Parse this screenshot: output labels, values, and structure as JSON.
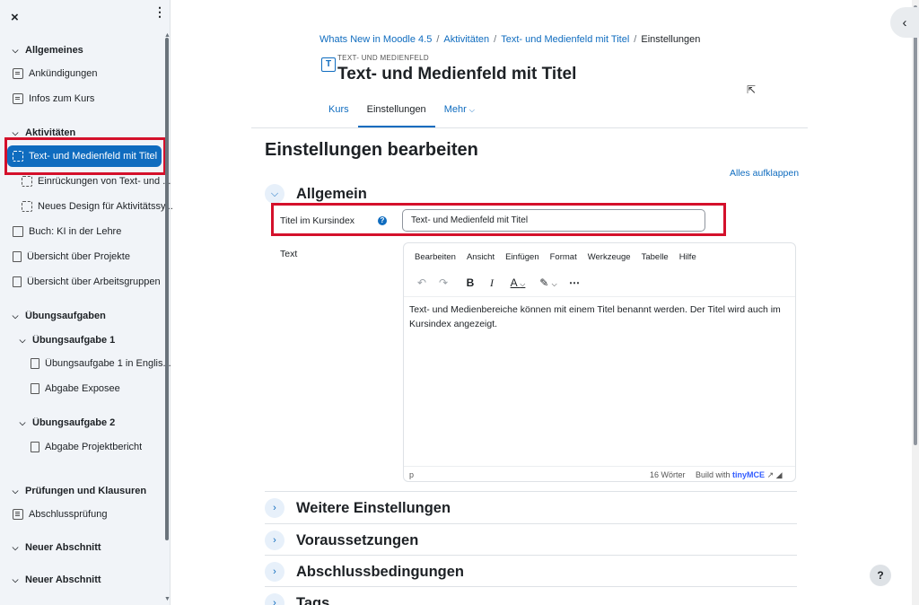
{
  "sidebar": {
    "close_icon": "×",
    "more_icon": "⋮",
    "items": [
      {
        "label": "Allgemeines"
      },
      {
        "label": "Ankündigungen"
      },
      {
        "label": "Infos zum Kurs"
      },
      {
        "label": "Aktivitäten"
      },
      {
        "label": "Text- und Medienfeld mit Titel"
      },
      {
        "label": "Einrückungen von Text- und ..."
      },
      {
        "label": "Neues Design für Aktivitätssy..."
      },
      {
        "label": "Buch: KI in der Lehre"
      },
      {
        "label": "Übersicht über Projekte"
      },
      {
        "label": "Übersicht über Arbeitsgruppen"
      },
      {
        "label": "Übungsaufgaben"
      },
      {
        "label": "Übungsaufgabe 1"
      },
      {
        "label": "Übungsaufgabe 1 in Englis..."
      },
      {
        "label": "Abgabe Exposee"
      },
      {
        "label": "Übungsaufgabe 2"
      },
      {
        "label": "Abgabe Projektbericht"
      },
      {
        "label": "Prüfungen und Klausuren"
      },
      {
        "label": "Abschlussprüfung"
      },
      {
        "label": "Neuer Abschnitt"
      },
      {
        "label": "Neuer Abschnitt"
      }
    ]
  },
  "breadcrumb": {
    "items": [
      "Whats New in Moodle 4.5",
      "Aktivitäten",
      "Text- und Medienfeld mit Titel",
      "Einstellungen"
    ]
  },
  "activity": {
    "type": "TEXT- UND MEDIENFELD",
    "title": "Text- und Medienfeld mit Titel"
  },
  "tabs": [
    "Kurs",
    "Einstellungen",
    "Mehr"
  ],
  "page": {
    "heading": "Einstellungen bearbeiten",
    "expand_all": "Alles aufklappen"
  },
  "sections": [
    {
      "title": "Allgemein"
    },
    {
      "title": "Weitere Einstellungen"
    },
    {
      "title": "Voraussetzungen"
    },
    {
      "title": "Abschlussbedingungen"
    },
    {
      "title": "Tags"
    }
  ],
  "form": {
    "title_label": "Titel im Kursindex",
    "title_value": "Text- und Medienfeld mit Titel",
    "text_label": "Text"
  },
  "editor": {
    "menu": [
      "Bearbeiten",
      "Ansicht",
      "Einfügen",
      "Format",
      "Werkzeuge",
      "Tabelle",
      "Hilfe"
    ],
    "content": "Text- und Medienbereiche können mit einem Titel benannt werden. Der Titel wird auch im Kursindex angezeigt.",
    "path": "p",
    "word_count": "16 Wörter",
    "build_with": "Build with",
    "brand": "tinyMCE"
  },
  "colors": {
    "accent": "#0f6cbf",
    "highlight_box": "#d4102b"
  }
}
